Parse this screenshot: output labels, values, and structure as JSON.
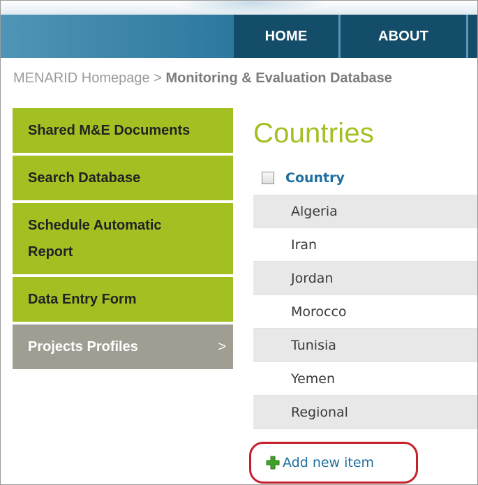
{
  "header": {
    "nav": [
      {
        "label": "HOME"
      },
      {
        "label": "ABOUT"
      }
    ]
  },
  "breadcrumb": {
    "home": "MENARID Homepage",
    "separator": ">",
    "current": "Monitoring & Evaluation Database"
  },
  "sidebar": {
    "items": [
      {
        "label": "Shared M&E Documents"
      },
      {
        "label_line1": "Search Database"
      },
      {
        "label_line1": "Schedule Automatic",
        "label_line2": "Report"
      },
      {
        "label": "Data Entry Form"
      },
      {
        "label": "Projects Profiles",
        "chevron": ">"
      }
    ]
  },
  "main": {
    "title": "Countries",
    "column_header": "Country",
    "rows": [
      "Algeria",
      "Iran",
      "Jordan",
      "Morocco",
      "Tunisia",
      "Yemen",
      "Regional"
    ],
    "add_item_label": "Add new item"
  },
  "colors": {
    "nav_bg": "#144d6a",
    "sidebar_green": "#a3c023",
    "sidebar_gray": "#a09d92",
    "title_green": "#a3c023",
    "link_blue": "#1f6fa0",
    "highlight_red": "#c4202b"
  },
  "icons": {
    "add": "green-plus-icon",
    "checkbox": "checkbox-icon",
    "chevron": "chevron-right-icon"
  }
}
